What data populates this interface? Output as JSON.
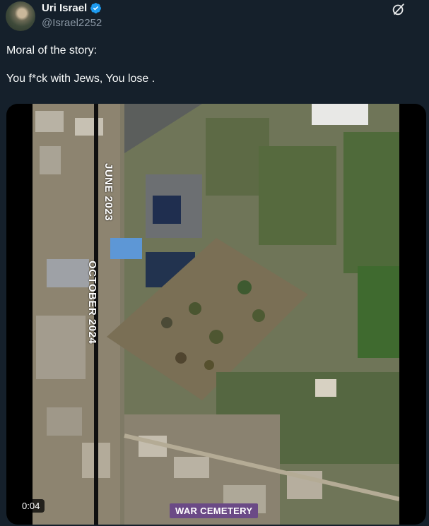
{
  "author": {
    "display_name": "Uri Israel",
    "handle": "@Israel2252",
    "avatar_icon": "avatar-image",
    "verified_icon": "verified-badge-icon",
    "verified_color": "#1d9bf0"
  },
  "header": {
    "grok_icon": "grok-icon"
  },
  "tweet": {
    "text": "Moral of the story:\n\nYou f*ck with Jews, You lose ."
  },
  "media": {
    "label_top": "JUNE 2023",
    "label_bottom": "OCTOBER 2024",
    "caption": "WAR CEMETERY",
    "caption_color": "#6b4a86",
    "timestamp": "0:04"
  },
  "colors": {
    "background": "#15202b",
    "text_primary": "#f7f9f9",
    "text_secondary": "#8b98a5"
  }
}
